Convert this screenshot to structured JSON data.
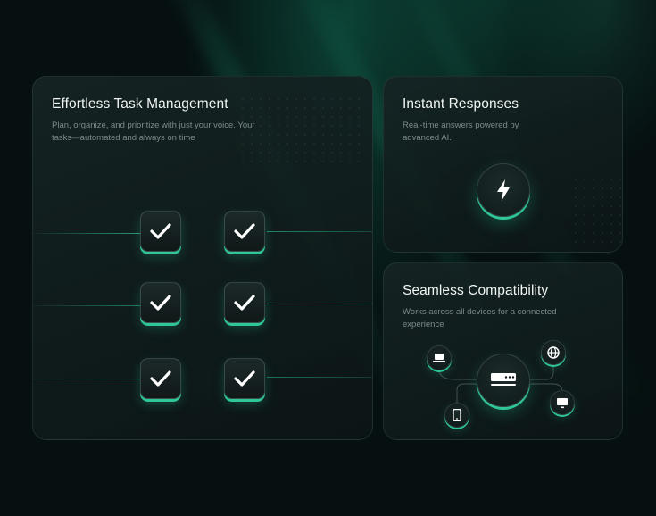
{
  "colors": {
    "accent": "#2fc79a",
    "background": "#061010"
  },
  "task_card": {
    "title": "Effortless Task Management",
    "description": "Plan, organize, and prioritize with just your voice. Your tasks—automated and always on time",
    "checks": [
      "checkmark-icon",
      "checkmark-icon",
      "checkmark-icon",
      "checkmark-icon",
      "checkmark-icon",
      "checkmark-icon"
    ]
  },
  "instant_card": {
    "title": "Instant Responses",
    "description": "Real-time answers powered by advanced AI.",
    "icon": "lightning-bolt-icon"
  },
  "compat_card": {
    "title": "Seamless Compatibility",
    "description": "Works across all devices for a connected experience",
    "hub_icon": "router-icon",
    "device_icons": [
      "laptop-icon",
      "globe-icon",
      "phone-icon",
      "monitor-icon"
    ]
  }
}
